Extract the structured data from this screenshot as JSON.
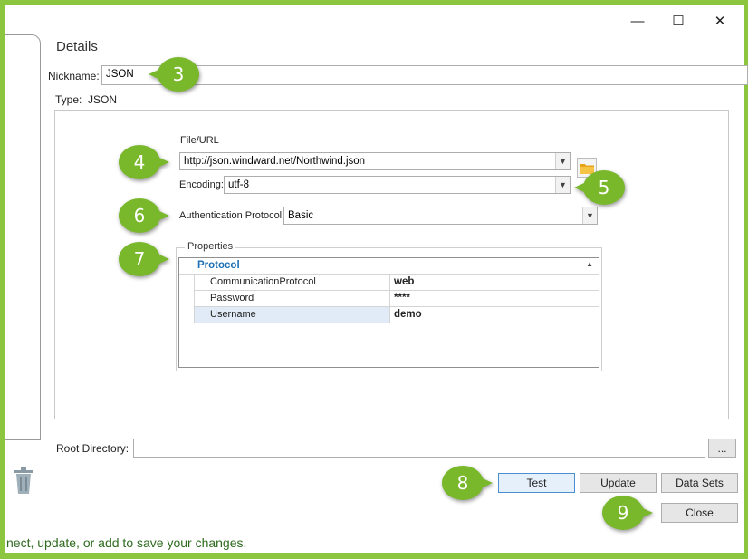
{
  "window": {
    "minimize_glyph": "—",
    "maximize_glyph": "☐",
    "close_glyph": "✕"
  },
  "details": {
    "title": "Details",
    "nickname_label": "Nickname:",
    "nickname_value": "JSON",
    "type_label": "Type:",
    "type_value": "JSON"
  },
  "connection": {
    "file_url_label": "File/URL",
    "file_url_value": "http://json.windward.net/Northwind.json",
    "encoding_label": "Encoding:",
    "encoding_value": "utf-8",
    "auth_label": "Authentication Protocol",
    "auth_value": "Basic"
  },
  "properties": {
    "legend": "Properties",
    "category": "Protocol",
    "rows": [
      {
        "name": "CommunicationProtocol",
        "value": "web"
      },
      {
        "name": "Password",
        "value": "****"
      },
      {
        "name": "Username",
        "value": "demo"
      }
    ]
  },
  "root_directory": {
    "label": "Root Directory:",
    "value": "",
    "browse_label": "..."
  },
  "buttons": {
    "test": "Test",
    "update": "Update",
    "data_sets": "Data Sets",
    "close": "Close"
  },
  "status": {
    "text": "nect, update, or add to save your changes."
  },
  "callouts": [
    "3",
    "4",
    "5",
    "6",
    "7",
    "8",
    "9"
  ],
  "colors": {
    "frame_green": "#8cc63f",
    "callout_green": "#78b82a",
    "category_blue": "#1a6fb5",
    "status_text": "#2e6b1f"
  }
}
